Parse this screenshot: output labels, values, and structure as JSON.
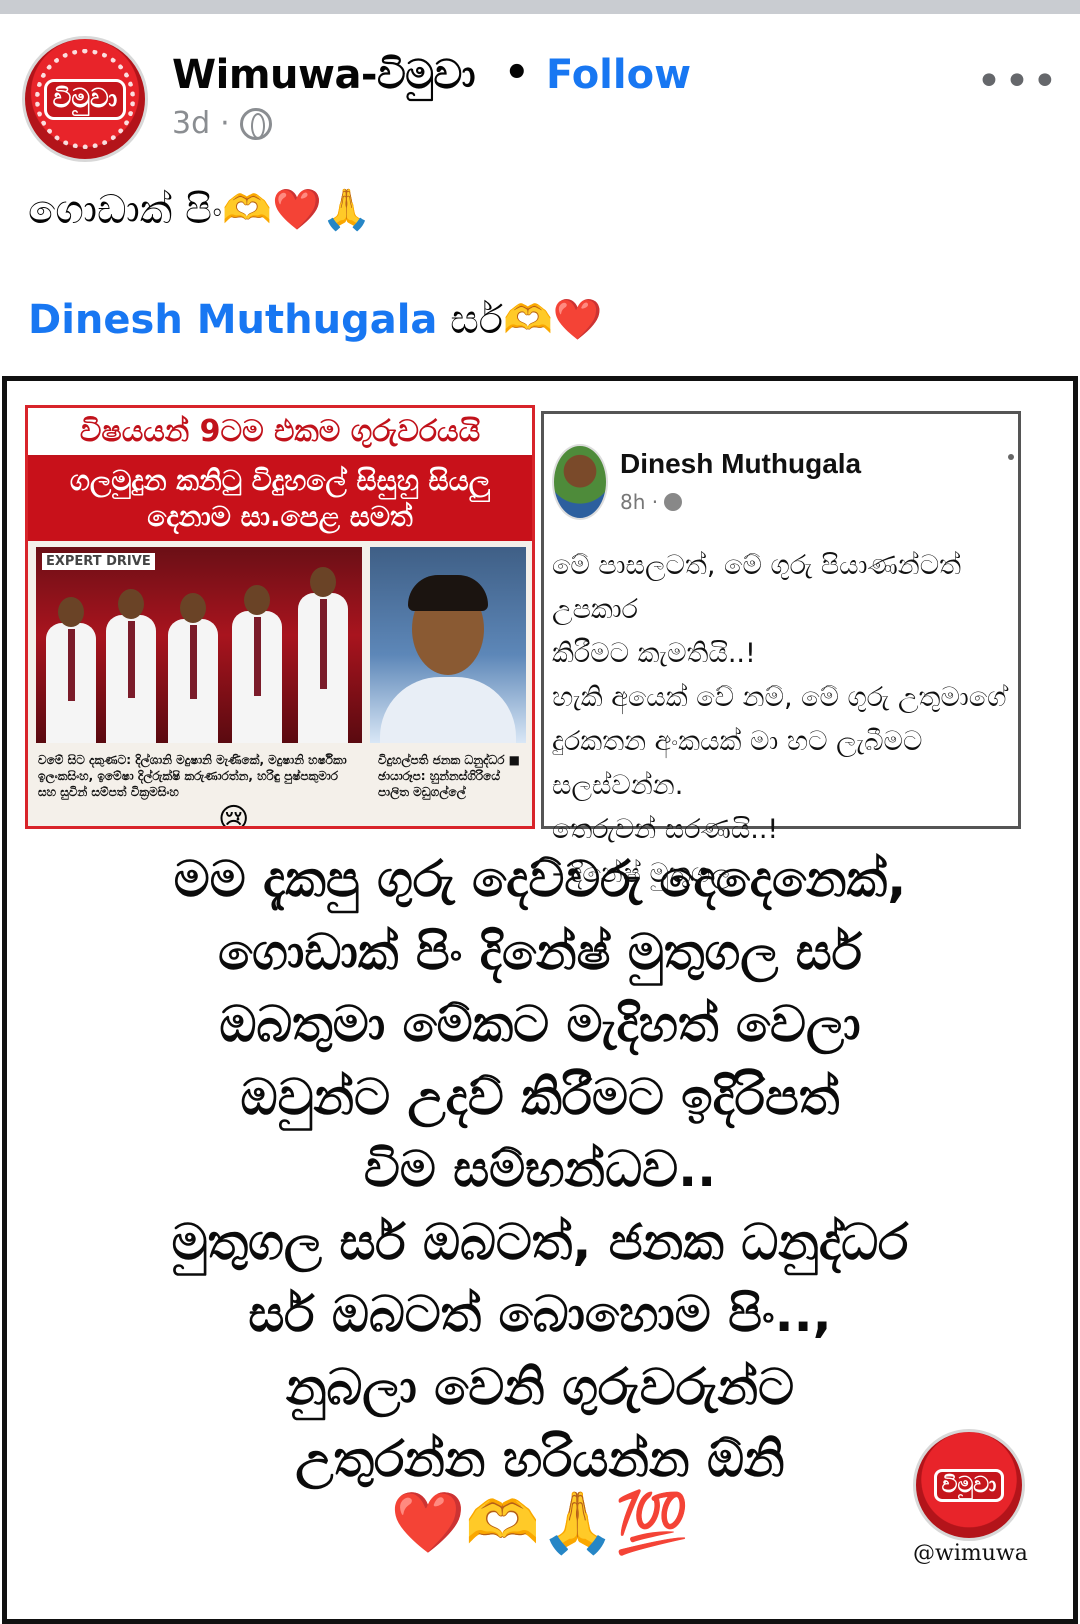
{
  "post": {
    "page_name": "Wimuwa-විමුවා",
    "separator": "•",
    "follow_label": "Follow",
    "age": "3d",
    "age_sep": "·",
    "more_label": "•••",
    "avatar_text": "විමුවා",
    "caption_line1": "ගොඩාක් පිං🫶❤️🙏",
    "mention_name": "Dinesh Muthugala",
    "caption_line2_suffix": " සර්🫶❤️"
  },
  "news": {
    "headline": "විෂයයන් 9ටම එකම ගුරුවරයයි",
    "subheadline": "ගලමුදුන කනිටු විදුහලේ සිසුහු සියලු දෙනාම සා.පෙළ සමත්",
    "brand": "EXPERT DRIVE",
    "caption_left": "වමේ සිට දකුණට: දිල්ශානි මදුෂානි මැණිකේ, මදුෂානි හර්ෂිකා ඉලංකසිංහ, ඉමේෂා දිල්රුක්ෂි කරුණාරත්න, හරිඳු පුෂ්පකුමාර සහ සුවින් සම්පත් වික්‍රමසිංහ",
    "caption_right": "විදුහල්පති ජනක ධනුද්ධර ■ ඡායාරූප: හුන්නස්ගිරියේ පාලිත මඩුගල්ලේ",
    "emoji": "😢"
  },
  "fb_card": {
    "name": "Dinesh Muthugala",
    "time": "8h ·",
    "lines": [
      "මේ පාසලටත්, මේ ගුරු පියාණන්ටත් උපකාර",
      "කිරීමට කැමතියි..!",
      "හැකි අයෙක් වේ නම්, මේ ගුරු උතුමාගේ",
      "දුරකතන අංකයක් මා හට ලැබීමට සලස්වන්න.",
      "තෙරුවන් සරණයි..!",
      "- දිනේෂ් මුතුගල"
    ]
  },
  "quote": {
    "lines": [
      "මම දැකපු ගුරු දෙව්වරු දෙදෙනෙක්,",
      "ගොඩාක් පිං දිනේෂ් මුතුගල සර්",
      "ඔබතුමා මේකට මැදිහත් වෙලා",
      "ඔවුන්ට උදව් කිරීමට ඉදිරිපත්",
      "විම සම්භන්ධව..",
      "මුතුගල සර් ඔබටත්, ජනක ධනුද්ධර",
      "සර් ඔබටත් බොහොම පිං..,",
      "නුබලා වෙනි ගුරුවරුන්ට",
      "උතුරන්න හරියන්න ඕනි"
    ],
    "emojis": "❤️🫶🙏💯"
  },
  "watermark": {
    "logo_text": "විමුවා",
    "handle": "@wimuwa"
  },
  "icons": {
    "globe": "globe-icon",
    "more": "more-options-icon"
  },
  "colors": {
    "link": "#1877f2",
    "muted": "#8a8d91",
    "brand_red": "#c8111a"
  }
}
